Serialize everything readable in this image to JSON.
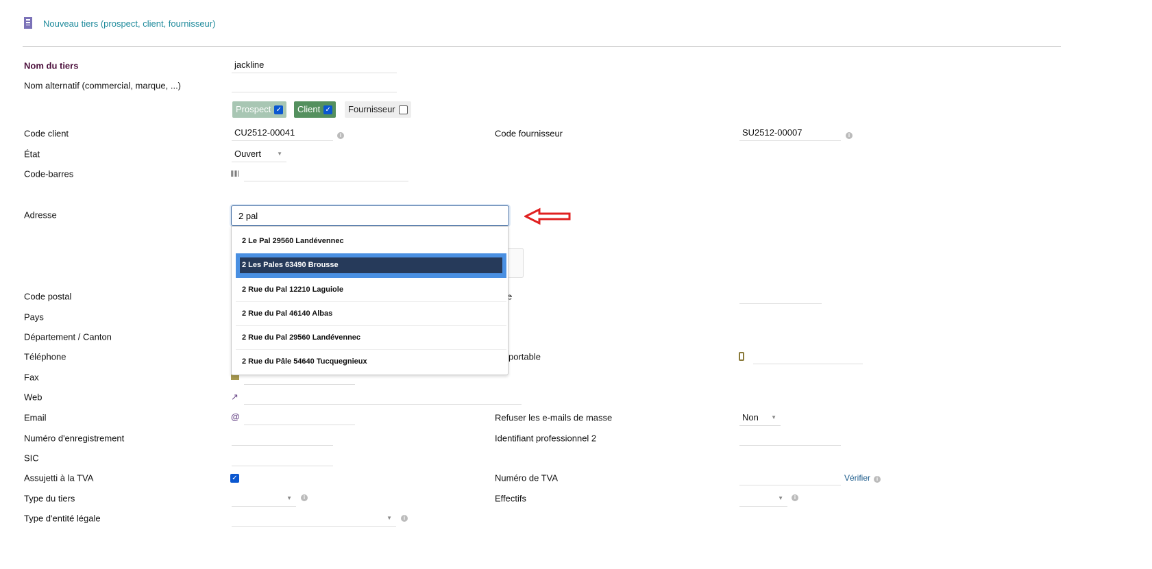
{
  "header": {
    "title": "Nouveau tiers (prospect, client, fournisseur)",
    "icon": "building-icon"
  },
  "fields": {
    "nom_tiers": {
      "label": "Nom du tiers",
      "value": "jackline"
    },
    "nom_alt": {
      "label": "Nom alternatif (commercial, marque, ...)",
      "value": ""
    },
    "types": {
      "prospect": "Prospect",
      "client": "Client",
      "fournisseur": "Fournisseur",
      "prospect_checked": true,
      "client_checked": true,
      "fournisseur_checked": false
    },
    "code_client": {
      "label": "Code client",
      "value": "CU2512-00041"
    },
    "code_fournisseur": {
      "label": "Code fournisseur",
      "value": "SU2512-00007"
    },
    "etat": {
      "label": "État",
      "value": "Ouvert"
    },
    "code_barres": {
      "label": "Code-barres"
    },
    "adresse": {
      "label": "Adresse",
      "value": "2 pal"
    },
    "code_postal": {
      "label": "Code postal"
    },
    "ville_fragment": "e",
    "pays": {
      "label": "Pays"
    },
    "departement": {
      "label": "Département / Canton"
    },
    "telephone": {
      "label": "Téléphone"
    },
    "portable": {
      "label": "portable"
    },
    "fax": {
      "label": "Fax"
    },
    "web": {
      "label": "Web"
    },
    "email": {
      "label": "Email"
    },
    "refuser": {
      "label": "Refuser les e-mails de masse",
      "value": "Non"
    },
    "num_enreg": {
      "label": "Numéro d'enregistrement"
    },
    "ident_pro2": {
      "label": "Identifiant professionnel 2"
    },
    "sic": {
      "label": "SIC"
    },
    "tva_assujetti": {
      "label": "Assujetti à la TVA",
      "checked": true
    },
    "num_tva": {
      "label": "Numéro de TVA",
      "verify": "Vérifier"
    },
    "type_tiers": {
      "label": "Type du tiers"
    },
    "effectifs": {
      "label": "Effectifs"
    },
    "type_entite": {
      "label": "Type d'entité légale"
    }
  },
  "suggestions": [
    "2 Le Pal 29560 Landévennec",
    "2 Les Pales 63490 Brousse",
    "2 Rue du Pal 12210 Laguiole",
    "2 Rue du Pal 46140 Albas",
    "2 Rue du Pal 29560 Landévennec",
    "2 Rue du Pâle 54640 Tucquegnieux"
  ],
  "colors": {
    "title": "#1e8a9b",
    "accent_arrow": "#e02020",
    "highlight": "#263a5a"
  }
}
